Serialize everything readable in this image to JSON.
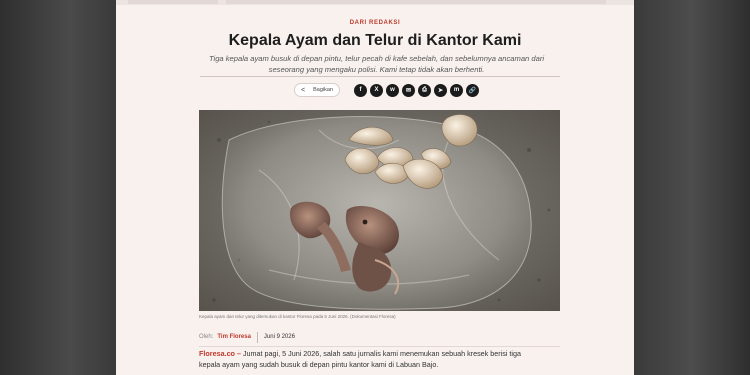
{
  "article": {
    "kicker": "DARI REDAKSI",
    "title": "Kepala Ayam dan Telur di Kantor Kami",
    "dek": "Tiga kepala ayam busuk di depan pintu, telur pecah di kafe sebelah, dan sebelumnya ancaman dari seseorang yang mengaku polisi. Kami tetap tidak akan berhenti.",
    "share": {
      "label": "Bagikan",
      "icons": [
        "facebook-icon",
        "x-icon",
        "whatsapp-icon",
        "email-icon",
        "print-icon",
        "telegram-icon",
        "messenger-icon",
        "link-icon"
      ],
      "glyphs": [
        "f",
        "X",
        "w",
        "✉",
        "⎙",
        "➤",
        "m",
        "🔗"
      ]
    },
    "image_caption": "Kepala ayam dan telur yang ditemukan di kantor Floresa pada 5 Juni 2026. (Dokumentasi Floresa)",
    "byline": {
      "by_label": "Oleh:",
      "author": "Tim Floresa",
      "date": "Juni 9 2026"
    },
    "body": {
      "brand": "Floresa.co –",
      "text": " Jumat pagi, 5 Juni 2026, salah satu jurnalis kami menemukan sebuah kresek berisi tiga kepala ayam yang sudah busuk di depan pintu kantor kami di Labuan Bajo."
    }
  },
  "colors": {
    "accent": "#c0392b",
    "page_background": "#f8f1ee",
    "share_button": "#1b1b1b"
  }
}
